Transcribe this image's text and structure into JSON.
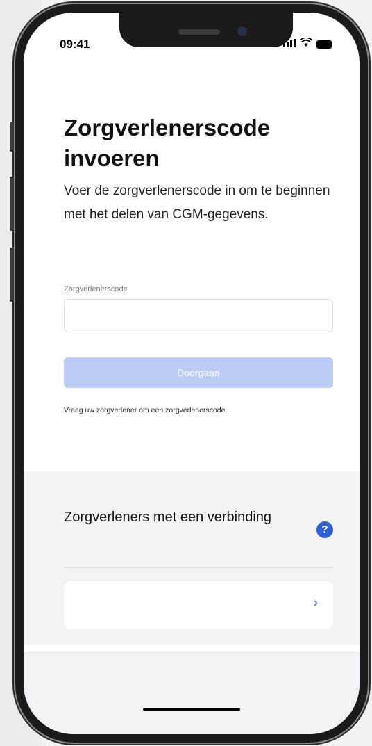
{
  "status_bar": {
    "time": "09:41",
    "signal_icon": "signal-icon",
    "wifi_icon": "wifi-icon",
    "battery_icon": "battery-icon"
  },
  "main": {
    "title": "Zorgverlenerscode invoeren",
    "description": "Voer de zorgverlenerscode in om te beginnen met het delen van CGM-gegevens.",
    "field_label": "Zorgverlenerscode",
    "field_value": "",
    "continue_label": "Doorgaan",
    "hint": "Vraag uw zorgverlener om een zorgverlenerscode."
  },
  "connected_section": {
    "title": "Zorgverleners met een verbinding",
    "help_icon": "help-icon",
    "chevron_icon": "chevron-right-icon"
  },
  "colors": {
    "accent": "#2f5fd6",
    "button_disabled": "#bcccf4",
    "section_bg": "#f3f3f4"
  }
}
